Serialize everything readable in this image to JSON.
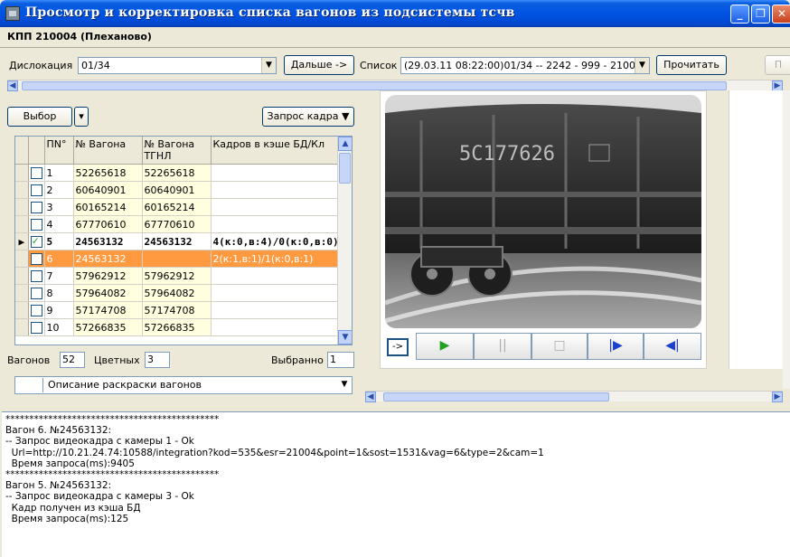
{
  "window": {
    "title": "Просмотр и корректировка списка вагонов из подсистемы тсчв"
  },
  "header": {
    "station": "КПП 210004 (Плеханово)"
  },
  "controls": {
    "dislocation_label": "Дислокация",
    "dislocation_value": "01/34",
    "next_button": "Дальше ->",
    "list_label": "Список",
    "list_value": "(29.03.11 08:22:00)01/34 -- 2242 - 999 - 2100",
    "read_button": "Прочитать",
    "extra_button": "П"
  },
  "left": {
    "select_button": "Выбор",
    "frame_request_button": "Запрос кадра ▼",
    "table": {
      "columns": [
        "ПN°",
        "№ Вагона",
        "№ Вагона ТГНЛ",
        "Кадров в кэше  БД/Кл"
      ],
      "rows": [
        {
          "n": "1",
          "wagon": "52265618",
          "tgnl": "52265618",
          "frames": "",
          "checked": false,
          "style": ""
        },
        {
          "n": "2",
          "wagon": "60640901",
          "tgnl": "60640901",
          "frames": "",
          "checked": false,
          "style": ""
        },
        {
          "n": "3",
          "wagon": "60165214",
          "tgnl": "60165214",
          "frames": "",
          "checked": false,
          "style": ""
        },
        {
          "n": "4",
          "wagon": "67770610",
          "tgnl": "67770610",
          "frames": "",
          "checked": false,
          "style": ""
        },
        {
          "n": "5",
          "wagon": "24563132",
          "tgnl": "24563132",
          "frames": "4(к:0,в:4)/0(к:0,в:0)",
          "checked": true,
          "style": "bold",
          "current": true
        },
        {
          "n": "6",
          "wagon": "24563132",
          "tgnl": "",
          "frames": "2(к:1,в:1)/1(к:0,в:1)",
          "checked": false,
          "style": "orange"
        },
        {
          "n": "7",
          "wagon": "57962912",
          "tgnl": "57962912",
          "frames": "",
          "checked": false,
          "style": ""
        },
        {
          "n": "8",
          "wagon": "57964082",
          "tgnl": "57964082",
          "frames": "",
          "checked": false,
          "style": ""
        },
        {
          "n": "9",
          "wagon": "57174708",
          "tgnl": "57174708",
          "frames": "",
          "checked": false,
          "style": ""
        },
        {
          "n": "10",
          "wagon": "57266835",
          "tgnl": "57266835",
          "frames": "",
          "checked": false,
          "style": ""
        }
      ]
    },
    "wagons_label": "Вагонов",
    "wagons_value": "52",
    "colored_label": "Цветных",
    "colored_value": "3",
    "selected_label": "Выбранно",
    "selected_value": "1",
    "description_combo": "Описание раскраски вагонов"
  },
  "viewer": {
    "wagon_number_on_image": "5С177626",
    "controls": {
      "arrow_small": "->",
      "play": "▶",
      "pause": "||",
      "stop": "□",
      "next_frame": "|▶",
      "prev_frame": "◀|"
    }
  },
  "log": {
    "text": "*********************************************\nВагон 6. №24563132:\n-- Запрос видеокадра с камеры 1 - Ok\n  Url=http://10.21.24.74:10588/integration?kod=535&esr=21004&point=1&sost=1531&vag=6&type=2&cam=1\n  Время запроса(ms):9405\n*********************************************\nВагон 5. №24563132:\n-- Запрос видеокадра с камеры 3 - Ok\n  Кадр получен из кэша БД\n  Время запроса(ms):125"
  },
  "colors": {
    "titlebar": "#0054e3",
    "highlight_row": "#ff9a40",
    "cell_yellow": "#ffffe0",
    "play_green": "#21a121",
    "media_blue": "#1a3fd0"
  }
}
